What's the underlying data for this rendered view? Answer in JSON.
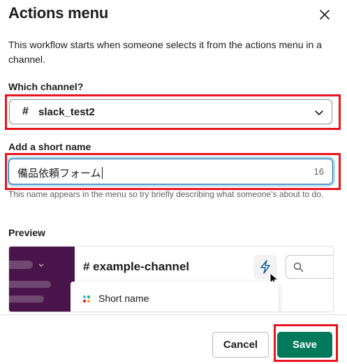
{
  "dialog": {
    "title": "Actions menu",
    "description": "This workflow starts when someone selects it from the actions menu in a channel."
  },
  "channel_field": {
    "label": "Which channel?",
    "hash_symbol": "#",
    "selected_value": "slack_test2"
  },
  "name_field": {
    "label": "Add a short name",
    "value": "備品依頼フォーム",
    "char_count": "16",
    "help_text": "This name appears in the menu so try briefly describing what someone's about to do."
  },
  "preview": {
    "label": "Preview",
    "channel_name": "# example-channel",
    "menu_item": "Short name"
  },
  "footer": {
    "cancel_label": "Cancel",
    "save_label": "Save"
  },
  "colors": {
    "highlight_red": "#e8141e",
    "save_green": "#007a5a",
    "sidebar_aubergine": "#4a154b",
    "focus_blue": "#1264a3"
  },
  "icons": [
    "close-icon",
    "chevron-down-icon",
    "lightning-bolt-icon",
    "pointer-cursor-icon",
    "search-icon",
    "slack-app-icon"
  ]
}
